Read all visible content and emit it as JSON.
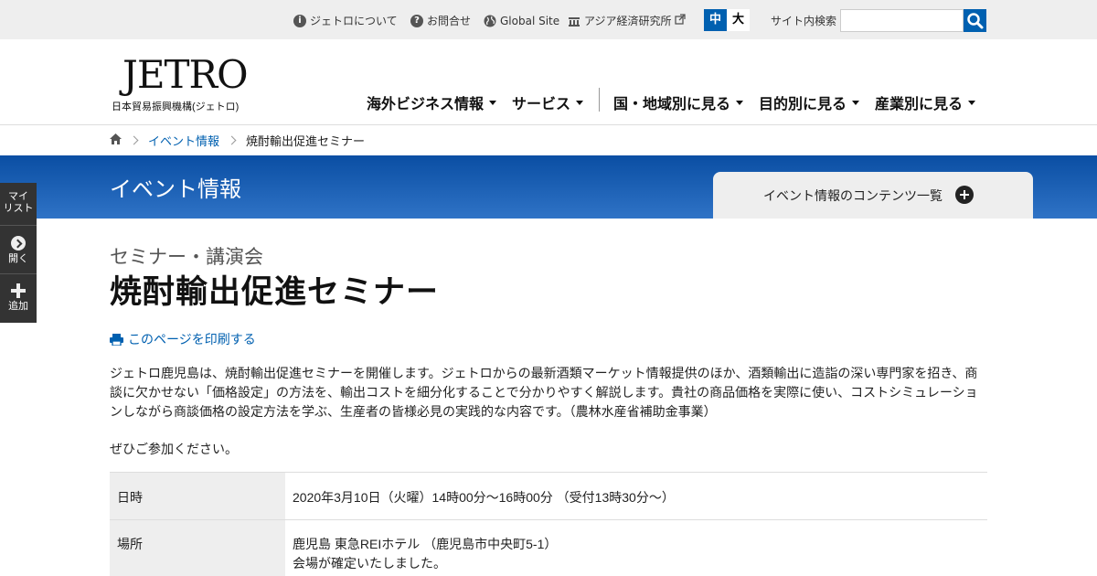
{
  "utility": {
    "about": "ジェトロについて",
    "contact": "お問合せ",
    "global": "Global Site",
    "ide": "アジア経済研究所",
    "size_medium": "中",
    "size_large": "大",
    "search_label": "サイト内検索",
    "search_value": ""
  },
  "header": {
    "logo_mark": "JETRO",
    "logo_sub": "日本貿易振興機構(ジェトロ)",
    "nav": [
      {
        "label": "海外ビジネス情報"
      },
      {
        "label": "サービス"
      },
      {
        "label": "国・地域別に見る"
      },
      {
        "label": "目的別に見る"
      },
      {
        "label": "産業別に見る"
      }
    ]
  },
  "breadcrumb": {
    "items": [
      "イベント情報",
      "焼酎輸出促進セミナー"
    ]
  },
  "band": {
    "title": "イベント情報",
    "contents_label": "イベント情報のコンテンツ一覧"
  },
  "side_panel": {
    "mylist": "マイ\nリスト",
    "open": "開く",
    "add": "追加"
  },
  "main": {
    "category": "セミナー・講演会",
    "title": "焼酎輸出促進セミナー",
    "print_label": "このページを印刷する",
    "body_lines": [
      "ジェトロ鹿児島は、焼酎輸出促進セミナーを開催します。ジェトロからの最新酒類マーケット情報提供のほか、酒類輸出に造詣の深い専門家を招き、商",
      "談に欠かせない「価格設定」の方法を、輸出コストを細分化することで分かりやすく解説します。貴社の商品価格を実際に使い、コストシミュレーショ",
      "ンしながら商談価格の設定方法を学ぶ、生産者の皆様必見の実践的な内容です。（農林水産省補助金事業）"
    ],
    "cta": "ぜひご参加ください。",
    "table": {
      "date_label": "日時",
      "date_value": "2020年3月10日（火曜）14時00分～16時00分 （受付13時30分～）",
      "place_label": "場所",
      "place_value_1": "鹿児島 東急REIホテル （鹿児島市中央町5-1）",
      "place_value_2": "会場が確定いたしました。"
    }
  },
  "colors": {
    "accent": "#0060b0",
    "band_top": "#0a4ea3",
    "band_bottom": "#2f73c6",
    "side_panel": "#333333"
  }
}
